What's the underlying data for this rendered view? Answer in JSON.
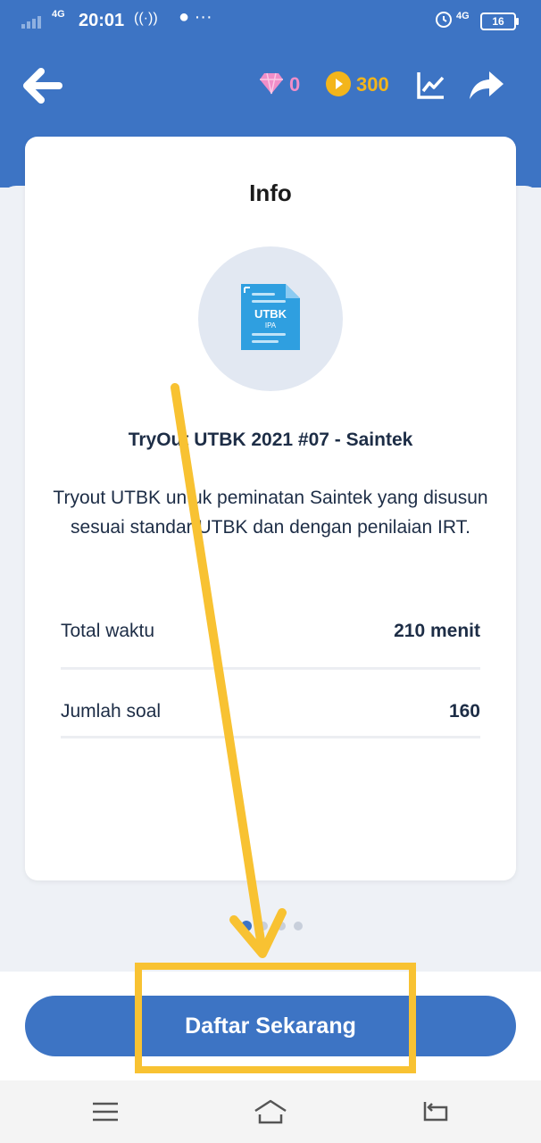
{
  "status_bar": {
    "time": "20:01",
    "network": "4G",
    "network2": "4G",
    "battery": "16"
  },
  "header": {
    "gem_count": "0",
    "coin_count": "300"
  },
  "card": {
    "title": "Info",
    "badge_line1": "UTBK",
    "badge_line2": "IPA",
    "tryout_title": "TryOut UTBK 2021 #07 - Saintek",
    "description": "Tryout UTBK untuk peminatan Saintek yang disusun sesuai standar UTBK dan dengan penilaian IRT.",
    "rows": [
      {
        "label": "Total waktu",
        "value": "210 menit"
      },
      {
        "label": "Jumlah soal",
        "value": "160"
      }
    ]
  },
  "cta": {
    "label": "Daftar Sekarang"
  },
  "colors": {
    "primary": "#3d74c4",
    "gem": "#f08ec8",
    "coin": "#f3b51b",
    "annotation": "#f8c232"
  }
}
